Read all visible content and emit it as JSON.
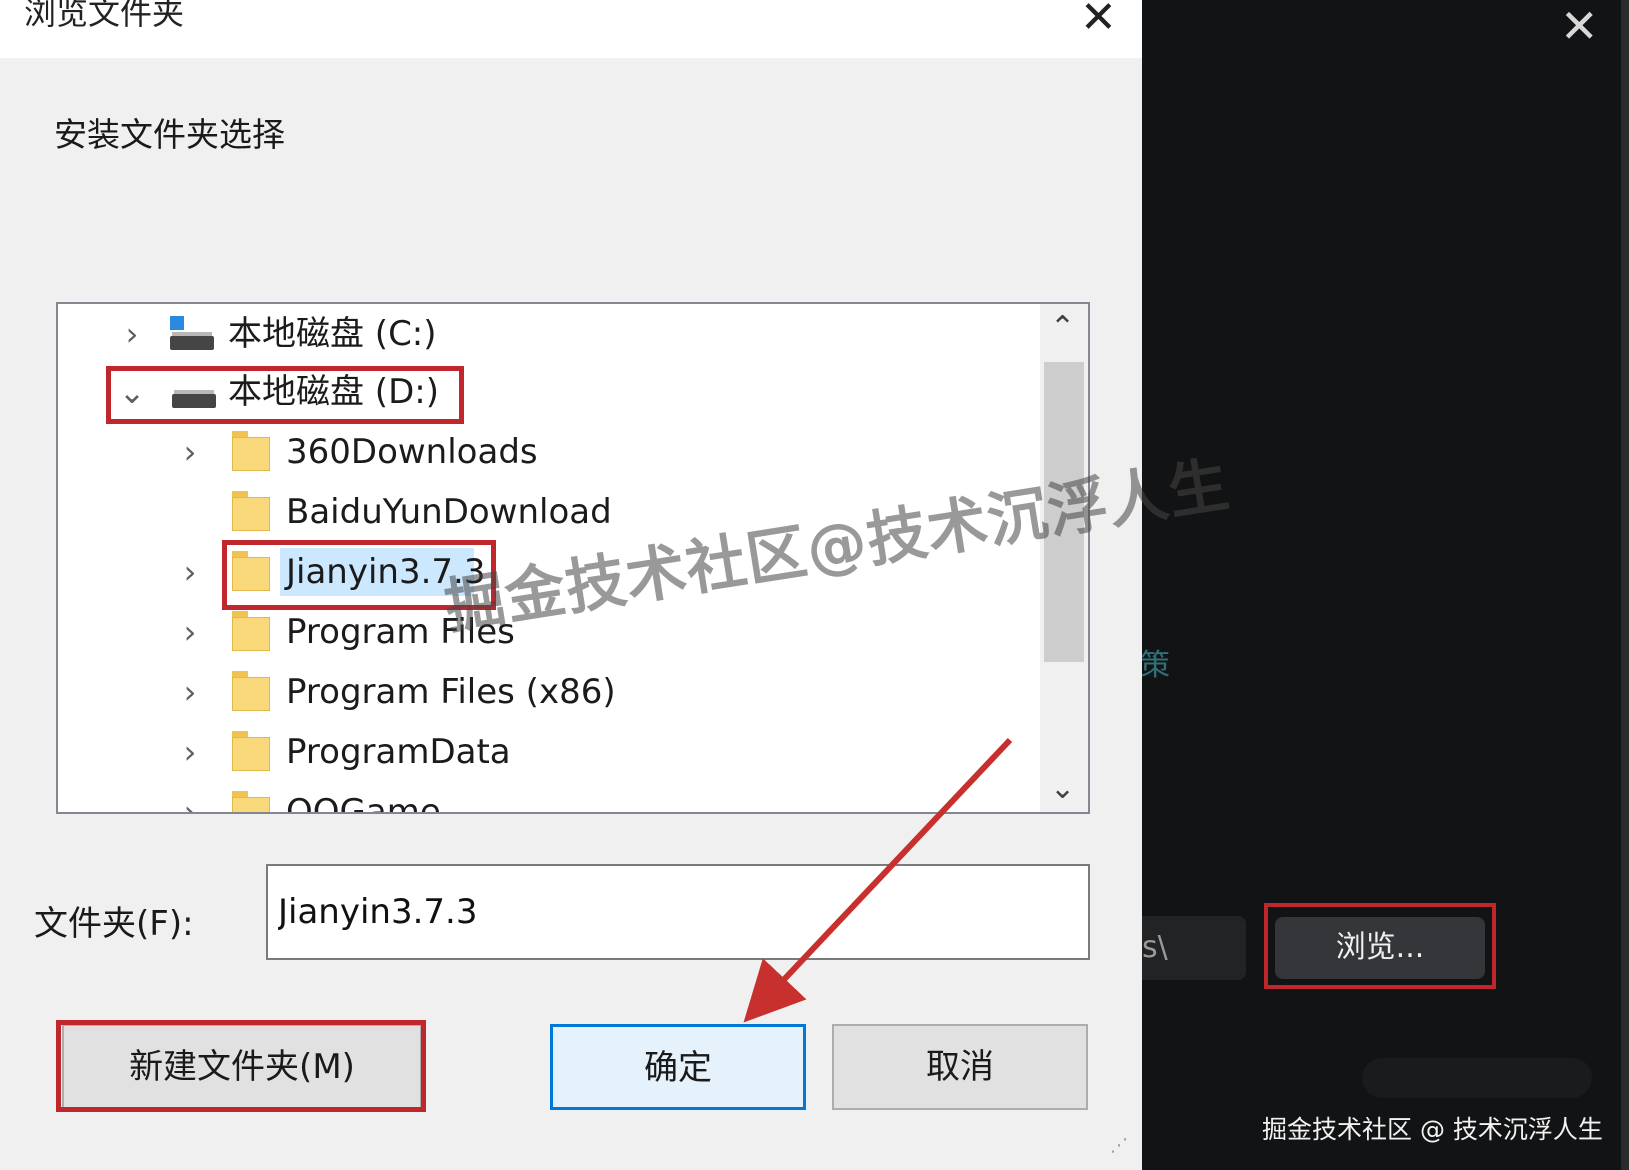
{
  "background_window": {
    "minimize_icon": "minimize-icon",
    "close_icon": "close-icon",
    "path_fragment": "s\\",
    "side_char": "策",
    "browse_label": "浏览...",
    "credit": "掘金技术社区 @ 技术沉浮人生"
  },
  "dialog": {
    "title": "浏览文件夹",
    "instruction": "安装文件夹选择",
    "close_glyph": "✕",
    "tree": {
      "items": [
        {
          "label": "本地磁盘 (C:)",
          "expanded": false,
          "icon": "drive-icon"
        },
        {
          "label": "本地磁盘 (D:)",
          "expanded": true,
          "icon": "drive-icon"
        },
        {
          "label": "360Downloads",
          "icon": "folder-icon",
          "has_children": true
        },
        {
          "label": "BaiduYunDownload",
          "icon": "folder-icon",
          "has_children": false
        },
        {
          "label": "Jianyin3.7.3",
          "icon": "folder-icon",
          "has_children": true,
          "selected": true
        },
        {
          "label": "Program Files",
          "icon": "folder-icon",
          "has_children": true
        },
        {
          "label": "Program Files (x86)",
          "icon": "folder-icon",
          "has_children": true
        },
        {
          "label": "ProgramData",
          "icon": "folder-icon",
          "has_children": true
        },
        {
          "label": "QQGame",
          "icon": "folder-icon",
          "has_children": true
        }
      ]
    },
    "folder_label": "文件夹(F):",
    "folder_value": "Jianyin3.7.3",
    "new_folder_button": "新建文件夹(M)",
    "ok_button": "确定",
    "cancel_button": "取消"
  },
  "watermark": "掘金技术社区@技术沉浮人生",
  "colors": {
    "highlight_red": "#c0272d",
    "selection_blue": "#cce8ff",
    "ok_border": "#0078d7",
    "dark_bg": "#121314"
  }
}
